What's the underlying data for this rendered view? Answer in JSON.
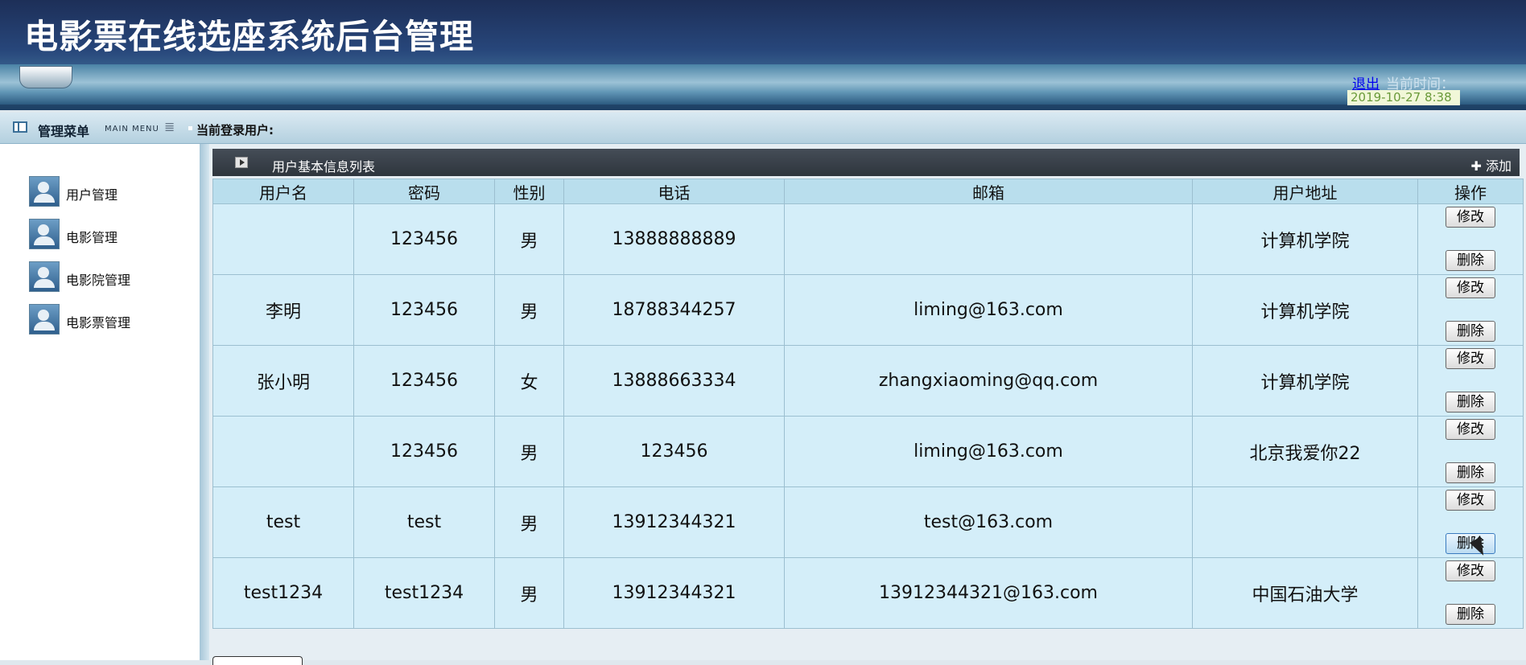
{
  "header": {
    "title": "电影票在线选座系统后台管理",
    "logout_label": "退出",
    "time_label": "当前时间：",
    "time_value": "2019-10-27 8:38"
  },
  "menubar": {
    "title": "管理菜单",
    "subtitle": "MAIN MENU",
    "current_user_label": "当前登录用户:"
  },
  "sidebar": {
    "items": [
      {
        "label": "用户管理",
        "icon": "user-admin-icon"
      },
      {
        "label": "电影管理",
        "icon": "user-admin-icon"
      },
      {
        "label": "电影院管理",
        "icon": "user-admin-icon"
      },
      {
        "label": "电影票管理",
        "icon": "user-admin-icon"
      }
    ]
  },
  "panel": {
    "title": "用户基本信息列表",
    "add_label": "添加"
  },
  "table": {
    "headers": [
      "用户名",
      "密码",
      "性别",
      "电话",
      "邮箱",
      "用户地址",
      "操作"
    ],
    "edit_label": "修改",
    "delete_label": "删除",
    "rows": [
      [
        "",
        "123456",
        "男",
        "13888888889",
        "",
        "计算机学院"
      ],
      [
        "李明",
        "123456",
        "男",
        "18788344257",
        "liming@163.com",
        "计算机学院"
      ],
      [
        "张小明",
        "123456",
        "女",
        "13888663334",
        "zhangxiaoming@qq.com",
        "计算机学院"
      ],
      [
        "",
        "123456",
        "男",
        "123456",
        "liming@163.com",
        "北京我爱你22"
      ],
      [
        "test",
        "test",
        "男",
        "13912344321",
        "test@163.com",
        ""
      ],
      [
        "test1234",
        "test1234",
        "男",
        "13912344321",
        "13912344321@163.com",
        "中国石油大学"
      ]
    ]
  },
  "colors": {
    "header_dark": "#1d2f58",
    "table_bg": "#d4eef9",
    "panel_head": "#3a424c"
  }
}
